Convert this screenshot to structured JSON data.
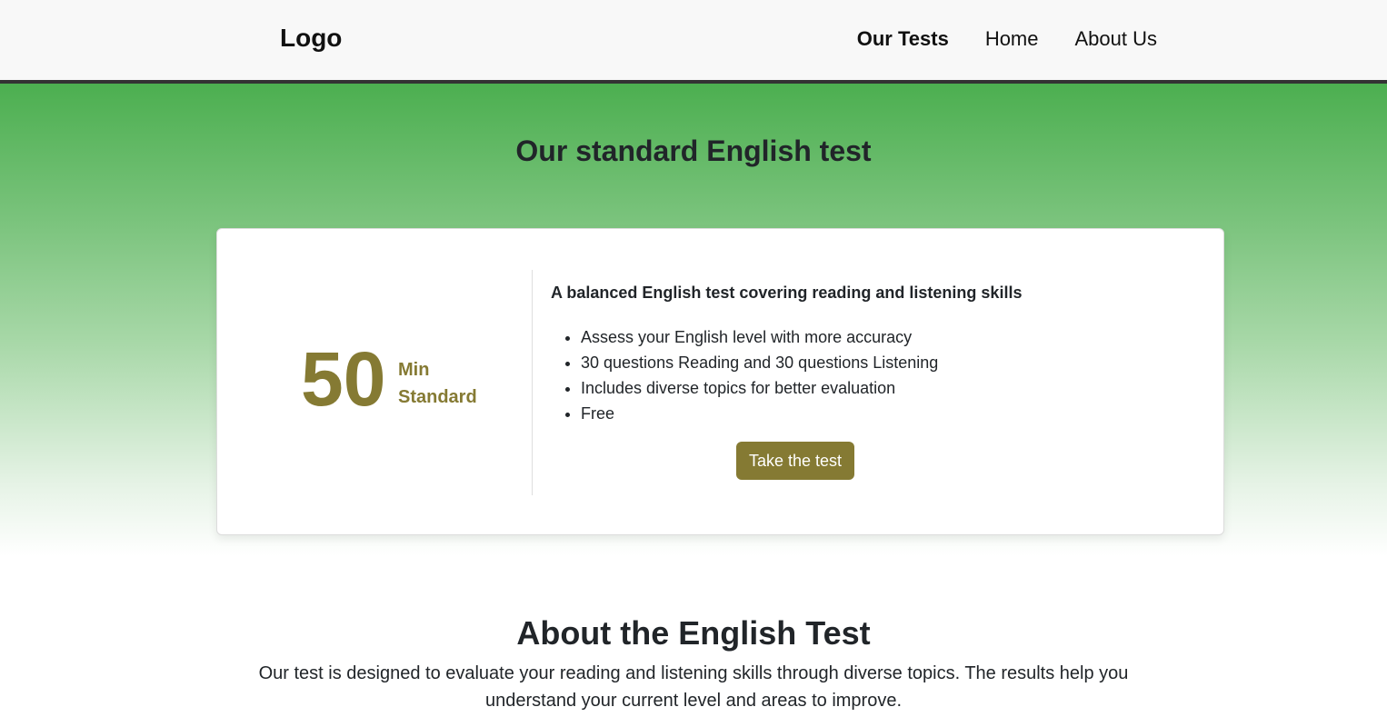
{
  "navbar": {
    "logo": "Logo",
    "links": [
      {
        "label": "Our Tests",
        "active": true
      },
      {
        "label": "Home",
        "active": false
      },
      {
        "label": "About Us",
        "active": false
      }
    ]
  },
  "hero": {
    "title": "Our standard English test"
  },
  "card": {
    "duration_number": "50",
    "duration_unit": "Min",
    "level": "Standard",
    "description": "A balanced English test covering reading and listening skills",
    "features": [
      "Assess your English level with more accuracy",
      "30 questions Reading and 30 questions Listening",
      "Includes diverse topics for better evaluation",
      "Free"
    ],
    "button_label": "Take the test"
  },
  "about": {
    "title": "About the English Test",
    "text": "Our test is designed to evaluate your reading and listening skills through diverse topics. The results help you understand your current level and areas to improve."
  },
  "colors": {
    "accent": "#857a33",
    "hero_green": "#4caf50",
    "navbar_bg": "#f8f8f8",
    "navbar_border": "#333333"
  }
}
